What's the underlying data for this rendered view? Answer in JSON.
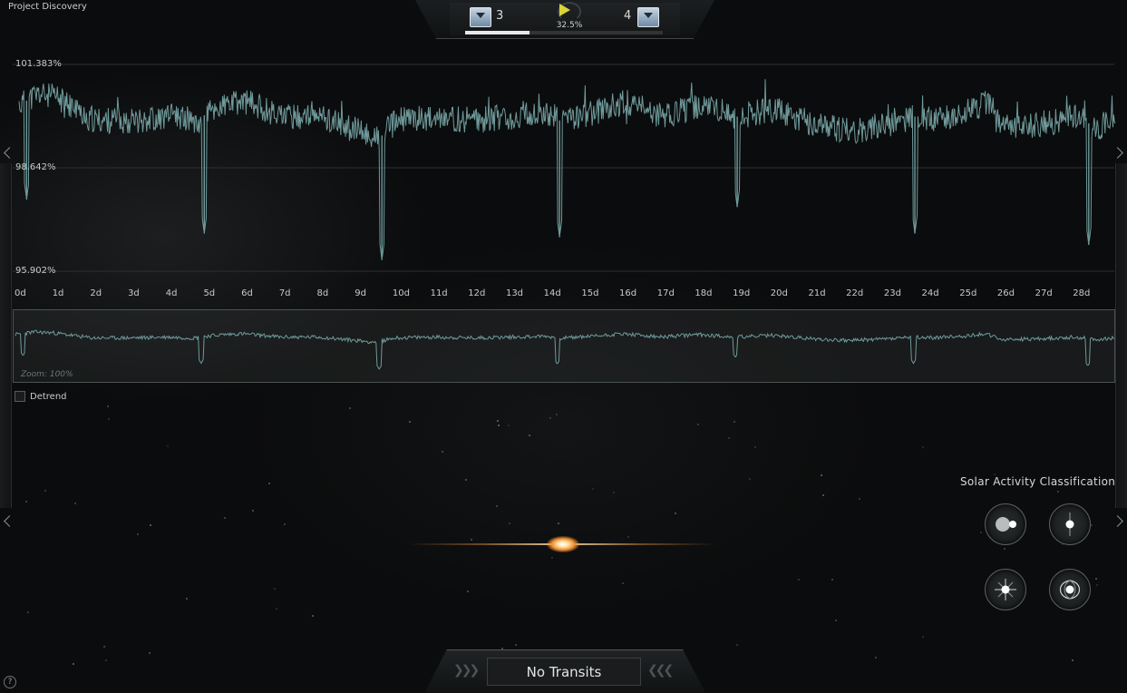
{
  "window": {
    "title": "Project Discovery"
  },
  "hud": {
    "rank_left": "3",
    "rank_right": "4",
    "progress_label": "32.5%",
    "progress_fraction": 0.325,
    "rank_icon": "rank-chevron-icon",
    "gauge_icon": "accuracy-gauge-icon"
  },
  "chart_data": {
    "type": "line",
    "title": "",
    "xlabel": "",
    "ylabel": "",
    "y_ticks": [
      "101.383%",
      "98.642%",
      "95.902%"
    ],
    "ylim": [
      95.902,
      101.383
    ],
    "x_ticks": [
      "0d",
      "1d",
      "2d",
      "3d",
      "4d",
      "5d",
      "6d",
      "7d",
      "8d",
      "9d",
      "10d",
      "11d",
      "12d",
      "13d",
      "14d",
      "15d",
      "16d",
      "17d",
      "18d",
      "19d",
      "20d",
      "21d",
      "22d",
      "23d",
      "24d",
      "25d",
      "26d",
      "27d",
      "28d"
    ],
    "xlim": [
      0,
      29
    ],
    "baseline": [
      [
        0.0,
        100.3
      ],
      [
        0.5,
        100.6
      ],
      [
        1.0,
        100.5
      ],
      [
        1.5,
        100.2
      ],
      [
        2.0,
        99.9
      ],
      [
        3.0,
        99.9
      ],
      [
        4.0,
        100.0
      ],
      [
        4.7,
        99.9
      ],
      [
        5.0,
        100.1
      ],
      [
        5.5,
        100.3
      ],
      [
        6.0,
        100.4
      ],
      [
        7.0,
        100.0
      ],
      [
        8.0,
        100.0
      ],
      [
        9.0,
        99.6
      ],
      [
        9.5,
        99.4
      ],
      [
        10.0,
        99.9
      ],
      [
        11.0,
        100.0
      ],
      [
        12.0,
        99.9
      ],
      [
        13.0,
        100.0
      ],
      [
        14.0,
        100.1
      ],
      [
        14.3,
        99.9
      ],
      [
        14.5,
        99.9
      ],
      [
        15.5,
        100.2
      ],
      [
        16.0,
        100.4
      ],
      [
        17.0,
        100.0
      ],
      [
        18.0,
        100.3
      ],
      [
        18.7,
        100.1
      ],
      [
        19.0,
        100.0
      ],
      [
        20.0,
        100.2
      ],
      [
        21.0,
        99.8
      ],
      [
        22.0,
        99.6
      ],
      [
        23.0,
        99.8
      ],
      [
        23.7,
        100.0
      ],
      [
        24.0,
        99.9
      ],
      [
        25.0,
        100.1
      ],
      [
        25.6,
        100.4
      ],
      [
        26.0,
        99.7
      ],
      [
        27.0,
        99.8
      ],
      [
        28.0,
        100.0
      ],
      [
        28.5,
        99.7
      ],
      [
        29.0,
        99.9
      ]
    ],
    "transit_dips": [
      {
        "x": 0.2,
        "y": 97.8
      },
      {
        "x": 4.9,
        "y": 96.9
      },
      {
        "x": 9.6,
        "y": 96.2
      },
      {
        "x": 14.3,
        "y": 96.8
      },
      {
        "x": 19.0,
        "y": 97.6
      },
      {
        "x": 23.7,
        "y": 96.9
      },
      {
        "x": 28.3,
        "y": 96.6
      }
    ],
    "grid": true,
    "line_color": "#6f9a9b"
  },
  "overview": {
    "zoom_label": "Zoom: 100%"
  },
  "detrend": {
    "label": "Detrend",
    "checked": false
  },
  "classification": {
    "title": "Solar Activity Classification",
    "options": [
      {
        "name": "binary-star-icon"
      },
      {
        "name": "single-star-icon"
      },
      {
        "name": "flaring-star-icon"
      },
      {
        "name": "magnetic-star-icon"
      }
    ]
  },
  "action": {
    "no_transits_label": "No Transits"
  },
  "help": {
    "label": "?"
  }
}
